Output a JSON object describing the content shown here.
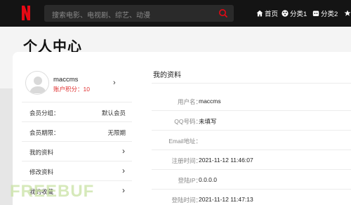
{
  "topbar": {
    "search_placeholder": "搜索电影、电视剧、综艺、动漫",
    "nav": [
      {
        "label": "首页",
        "icon": "home-icon"
      },
      {
        "label": "分类1",
        "icon": "category-icon"
      },
      {
        "label": "分类2",
        "icon": "category-icon"
      }
    ]
  },
  "page": {
    "title": "个人中心"
  },
  "user": {
    "name": "maccms",
    "points": "账户积分：10"
  },
  "left_rows": [
    {
      "label": "会员分组：",
      "value": "默认会员"
    },
    {
      "label": "会员期限：",
      "value": "无限期"
    },
    {
      "label": "我的资料"
    },
    {
      "label": "修改资料"
    },
    {
      "label": "我的收藏"
    }
  ],
  "profile": {
    "title": "我的资料",
    "fields": [
      {
        "label": "用户名：",
        "value": "maccms"
      },
      {
        "label": "QQ号码：",
        "value": "未填写"
      },
      {
        "label": "Email地址：",
        "value": ""
      },
      {
        "label": "注册时间：",
        "value": "2021-11-12 11:46:07"
      },
      {
        "label": "登陆IP：",
        "value": "0.0.0.0"
      },
      {
        "label": "登陆时间：",
        "value": "2021-11-12 11:47:13"
      }
    ]
  },
  "watermark": "FREEBUF",
  "colors": {
    "brand": "#e50914",
    "points": "#e03030",
    "topbar": "#141414"
  }
}
